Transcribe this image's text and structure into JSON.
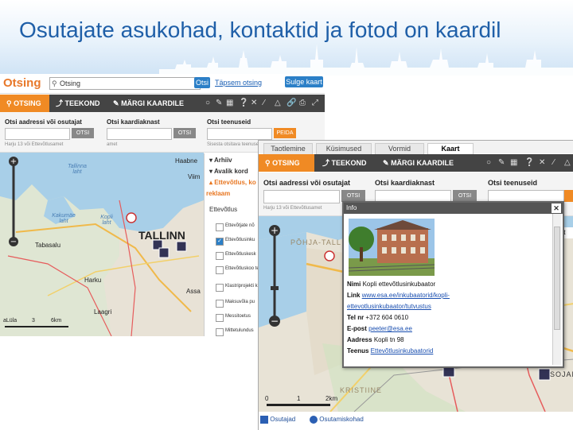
{
  "slide": {
    "title": "Osutajate asukohad, kontaktid ja fotod on kaardil"
  },
  "colors": {
    "accent": "#f08a24",
    "title": "#1f5fa8",
    "toolbar": "#444444",
    "link": "#1a5fb4"
  },
  "left": {
    "brand": "Otsing",
    "search_value": "Otsing",
    "search_button": "Otsi",
    "advanced_link": "Täpsem otsing",
    "close_button": "Sulge kaart",
    "toolbar": {
      "search": "OTSING",
      "route": "TEEKOND",
      "mark": "MÄRGI KAARDILE"
    },
    "fields": {
      "address_label": "Otsi aadressi või osutajat",
      "map_label": "Otsi kaardiaknast",
      "service_label": "Otsi teenuseid",
      "search_btn": "OTSI",
      "find_btn": "PEIDA",
      "hint1": "Harju 13 või Ettevõtlusamet",
      "hint2": "amet",
      "hint3": "Sisesta otsitava teenuse"
    },
    "map": {
      "city": "TALLINN",
      "bay1": "Tallinna laht",
      "bay2": "Kakumäe laht",
      "bay3": "Kopli laht",
      "place1": "Tabasalu",
      "place2": "Harku",
      "place3": "Laagri",
      "place4": "Assa",
      "place5": "Haabne",
      "place6": "Viim",
      "scale_a": "3",
      "scale_b": "6km",
      "scale_c": "aLüla"
    },
    "panel": {
      "archive": "Arhiiv",
      "open": "Avalik kord",
      "biz": "Ettevõtlus, ko",
      "ad": "reklaam",
      "section": "Ettevõtlus",
      "items": [
        "Ettevõtjate nõ",
        "Ettevõtlusinku",
        "Ettevõtluskesk",
        "Ettevõtluskoo teabepäevad",
        "Klastriprojekti kaasfinantsee",
        "Maksuvõla pu",
        "Messitoetus",
        "Mittetulundus"
      ]
    }
  },
  "right": {
    "tabs": [
      "Taotlemine",
      "Küsimused",
      "Vormid",
      "Kaart"
    ],
    "toolbar": {
      "search": "OTSING",
      "route": "TEEKOND",
      "mark": "MÄRGI KAARDILE"
    },
    "fields": {
      "address_label": "Otsi aadressi või osutajat",
      "map_label": "Otsi kaardiaknast",
      "service_label": "Otsi teenuseid",
      "search_btn": "OTSI",
      "search_btn2": "OTSI",
      "hint": "Harju 13 või Ettevõtlusamet"
    },
    "map": {
      "area1": "PÕHJA-TALL",
      "area2": "KRISTIINE",
      "area3": "SOJAM",
      "scale0": "0",
      "scale1": "1",
      "scale2": "2km",
      "edge": "rt"
    },
    "popup": {
      "title": "Info",
      "name_label": "Nimi",
      "name": "Kopli ettevõtlusinkubaator",
      "link_label": "Link",
      "link1": "www.esa.ee/inkubaatorid/kopli-",
      "link2": "ettevotlusinkubaator/tutvustus",
      "phone_label": "Tel nr",
      "phone": "+372 604 0610",
      "email_label": "E-post",
      "email": "peeter@esa.ee",
      "address_label": "Aadress",
      "address": "Kopli tn 98",
      "service_label": "Teenus",
      "service": "Ettevõtlusinkubaatorid"
    },
    "legend": {
      "providers": "Osutajad",
      "locations": "Osutamiskohad"
    }
  }
}
